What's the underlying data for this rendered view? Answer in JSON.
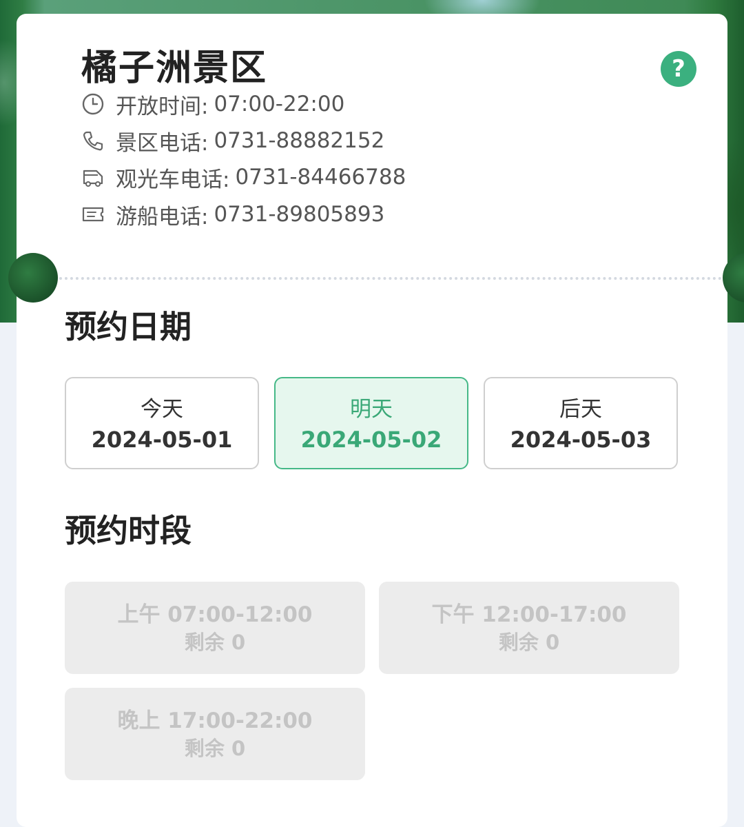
{
  "header": {
    "title": "橘子洲景区",
    "help_label": "?"
  },
  "info": [
    {
      "icon": "clock-icon",
      "label": "开放时间:",
      "value": "07:00-22:00"
    },
    {
      "icon": "phone-icon",
      "label": "景区电话:",
      "value": "0731-88882152"
    },
    {
      "icon": "shuttle-bus-icon",
      "label": "观光车电话:",
      "value": "0731-84466788"
    },
    {
      "icon": "boat-ticket-icon",
      "label": "游船电话:",
      "value": "0731-89805893"
    }
  ],
  "date_section": {
    "title": "预约日期",
    "dates": [
      {
        "label": "今天",
        "date": "2024-05-01",
        "selected": false
      },
      {
        "label": "明天",
        "date": "2024-05-02",
        "selected": true
      },
      {
        "label": "后天",
        "date": "2024-05-03",
        "selected": false
      }
    ]
  },
  "time_section": {
    "title": "预约时段",
    "slots": [
      {
        "label": "上午 07:00-12:00",
        "remaining": "剩余 0",
        "disabled": true
      },
      {
        "label": "下午 12:00-17:00",
        "remaining": "剩余 0",
        "disabled": true
      },
      {
        "label": "晚上 17:00-22:00",
        "remaining": "剩余 0",
        "disabled": true
      }
    ]
  },
  "colors": {
    "accent": "#3bb07f",
    "selected_bg": "#e6f7ee",
    "disabled_bg": "#ececec"
  }
}
